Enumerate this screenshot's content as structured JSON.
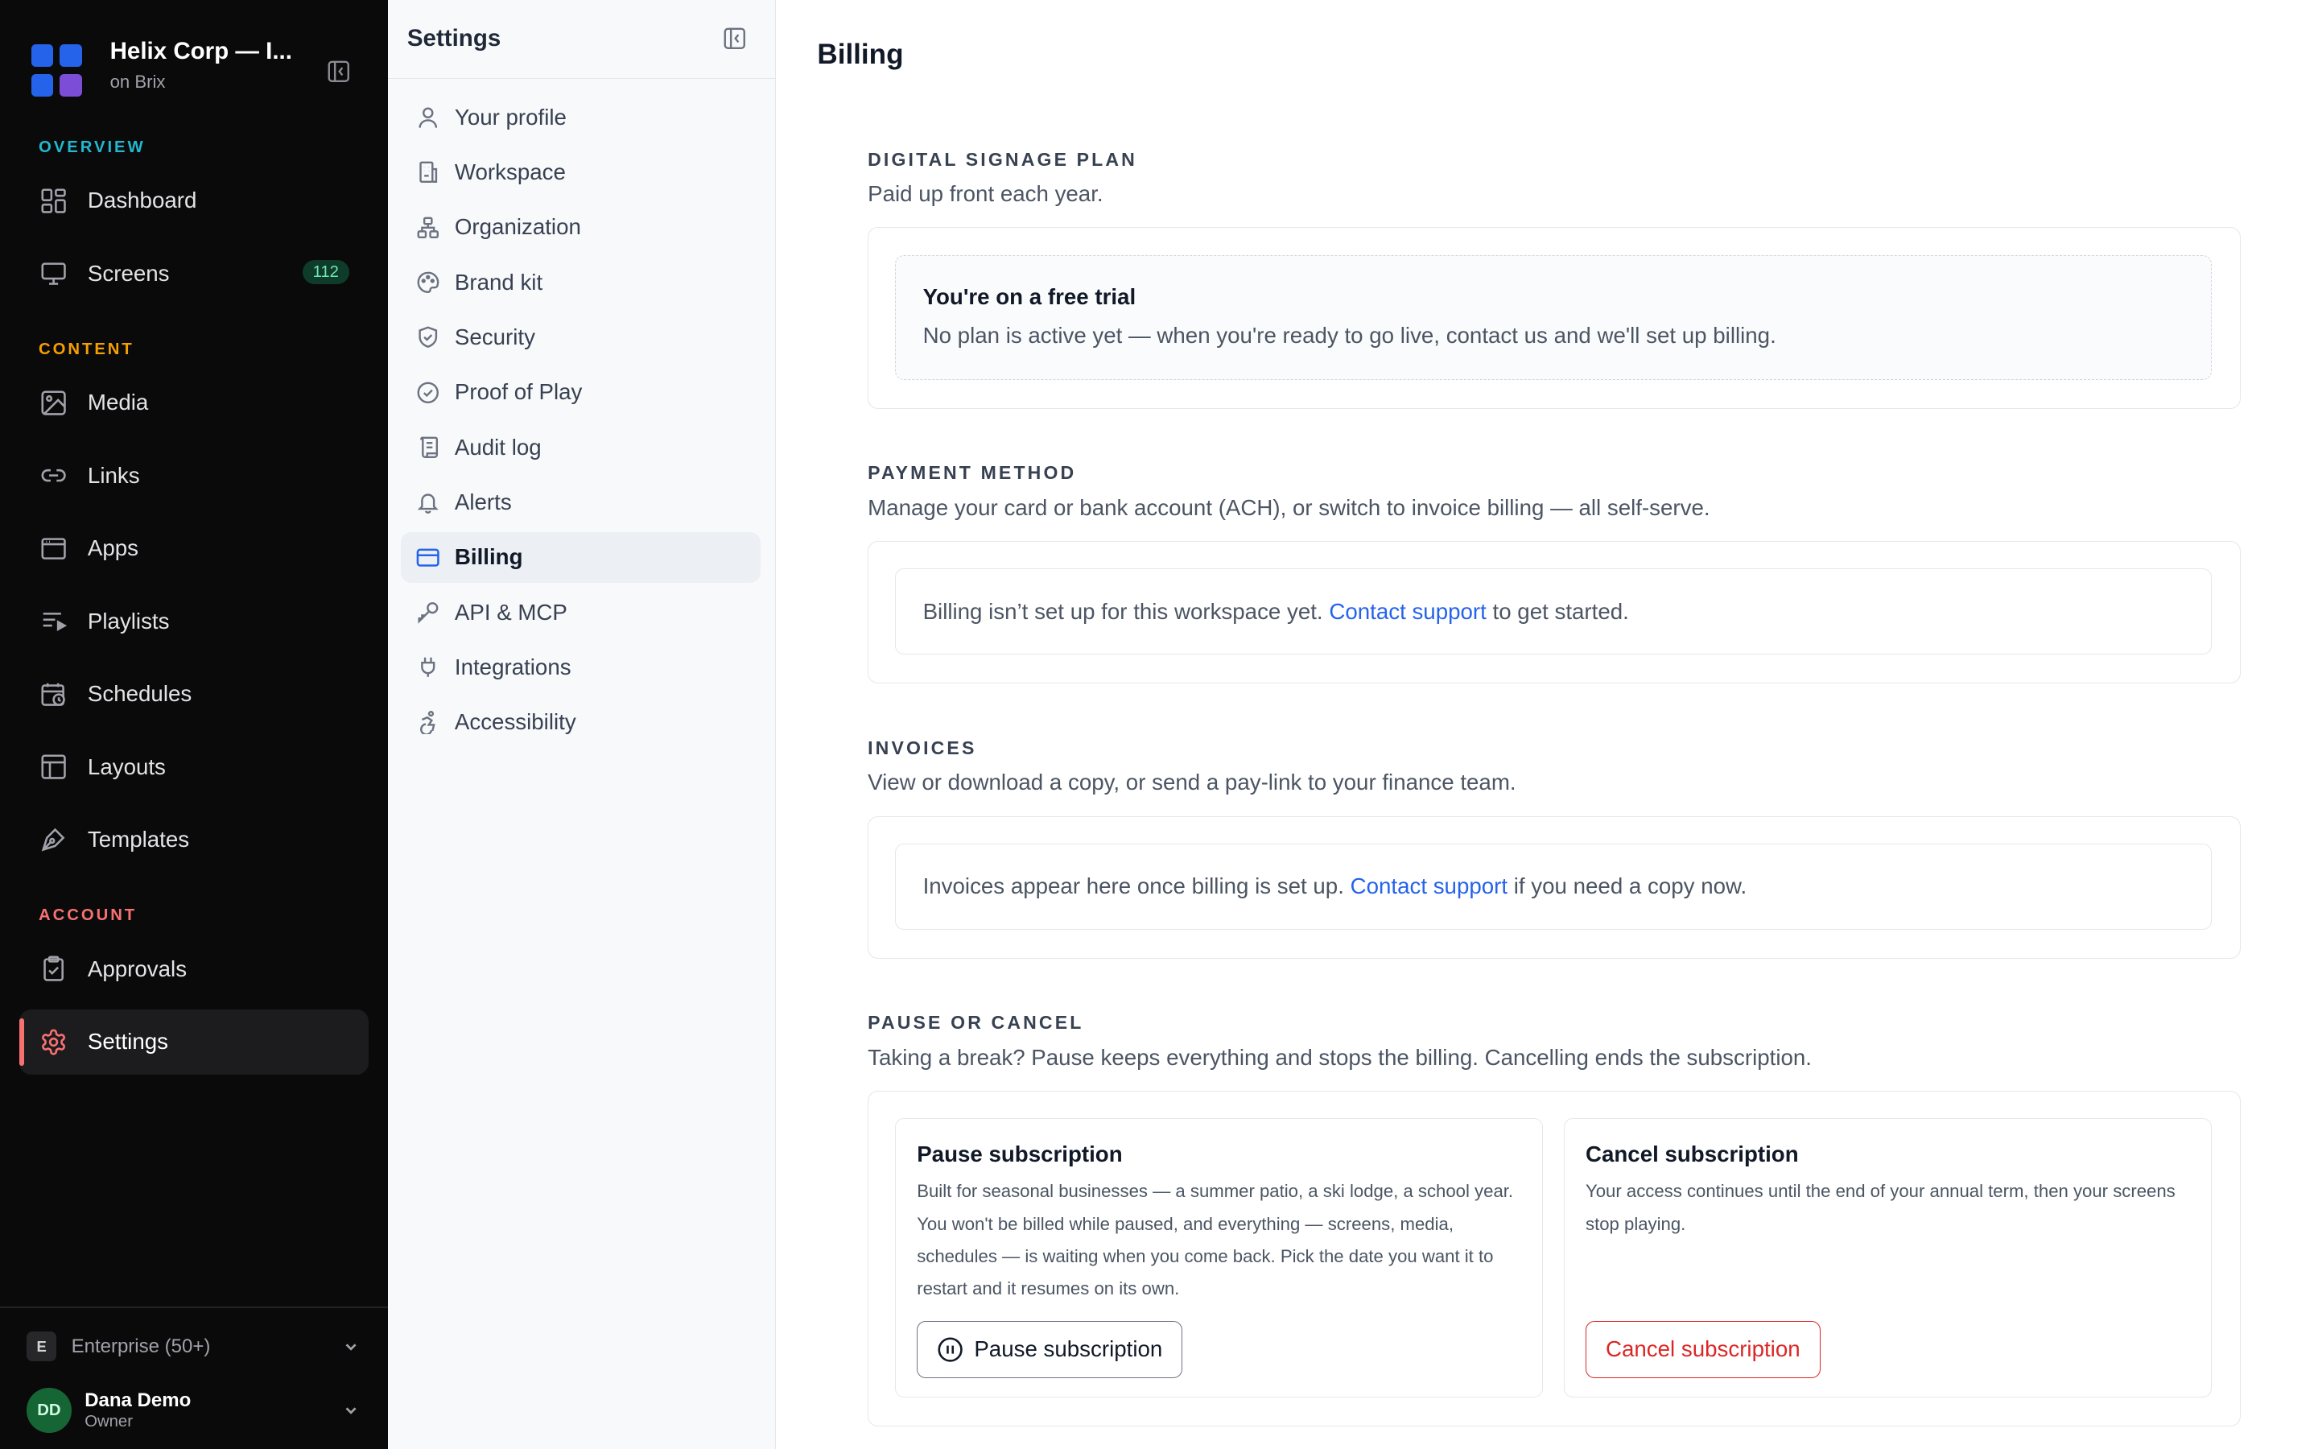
{
  "workspace": {
    "name": "Helix Corp — I...",
    "sub": "on Brix"
  },
  "sidebar": {
    "sections": [
      {
        "label": "OVERVIEW",
        "color": "#22b8cf"
      },
      {
        "label": "CONTENT",
        "color": "#f59f00"
      },
      {
        "label": "ACCOUNT",
        "color": "#f87171"
      }
    ],
    "items": [
      {
        "label": "Dashboard",
        "icon": "dashboard-icon"
      },
      {
        "label": "Screens",
        "icon": "monitor-icon",
        "badge": "112"
      },
      {
        "label": "Media",
        "icon": "image-icon"
      },
      {
        "label": "Links",
        "icon": "link-icon"
      },
      {
        "label": "Apps",
        "icon": "app-window-icon"
      },
      {
        "label": "Playlists",
        "icon": "playlist-icon"
      },
      {
        "label": "Schedules",
        "icon": "calendar-clock-icon"
      },
      {
        "label": "Layouts",
        "icon": "layout-icon"
      },
      {
        "label": "Templates",
        "icon": "pen-tool-icon"
      },
      {
        "label": "Approvals",
        "icon": "clipboard-check-icon"
      },
      {
        "label": "Settings",
        "icon": "gear-icon",
        "active": true
      }
    ],
    "plan": {
      "badge": "E",
      "label": "Enterprise (50+)"
    },
    "user": {
      "initials": "DD",
      "name": "Dana Demo",
      "role": "Owner"
    }
  },
  "settings_nav": {
    "title": "Settings",
    "items": [
      {
        "label": "Your profile",
        "icon": "user-icon"
      },
      {
        "label": "Workspace",
        "icon": "building-icon"
      },
      {
        "label": "Organization",
        "icon": "org-chart-icon"
      },
      {
        "label": "Brand kit",
        "icon": "palette-icon"
      },
      {
        "label": "Security",
        "icon": "shield-icon"
      },
      {
        "label": "Proof of Play",
        "icon": "check-circle-icon"
      },
      {
        "label": "Audit log",
        "icon": "scroll-icon"
      },
      {
        "label": "Alerts",
        "icon": "bell-icon"
      },
      {
        "label": "Billing",
        "icon": "credit-card-icon",
        "active": true
      },
      {
        "label": "API & MCP",
        "icon": "key-icon"
      },
      {
        "label": "Integrations",
        "icon": "plug-icon"
      },
      {
        "label": "Accessibility",
        "icon": "accessibility-icon"
      }
    ]
  },
  "main": {
    "title": "Billing",
    "plan": {
      "label": "DIGITAL SIGNAGE PLAN",
      "desc": "Paid up front each year.",
      "trial_title": "You're on a free trial",
      "trial_desc": "No plan is active yet — when you're ready to go live, contact us and we'll set up billing."
    },
    "payment": {
      "label": "PAYMENT METHOD",
      "desc": "Manage your card or bank account (ACH), or switch to invoice billing — all self-serve.",
      "note_before": "Billing isn’t set up for this workspace yet.",
      "link": "Contact support",
      "note_after": "to get started."
    },
    "invoices": {
      "label": "INVOICES",
      "desc": "View or download a copy, or send a pay-link to your finance team.",
      "note_before": "Invoices appear here once billing is set up.",
      "link": "Contact support",
      "note_after": "if you need a copy now."
    },
    "pause_cancel": {
      "label": "PAUSE OR CANCEL",
      "desc": "Taking a break? Pause keeps everything and stops the billing. Cancelling ends the subscription.",
      "pause": {
        "title": "Pause subscription",
        "desc": "Built for seasonal businesses — a summer patio, a ski lodge, a school year. You won't be billed while paused, and everything — screens, media, schedules — is waiting when you come back. Pick the date you want it to restart and it resumes on its own.",
        "button": "Pause subscription"
      },
      "cancel": {
        "title": "Cancel subscription",
        "desc": "Your access continues until the end of your annual term, then your screens stop playing.",
        "button": "Cancel subscription"
      }
    }
  }
}
